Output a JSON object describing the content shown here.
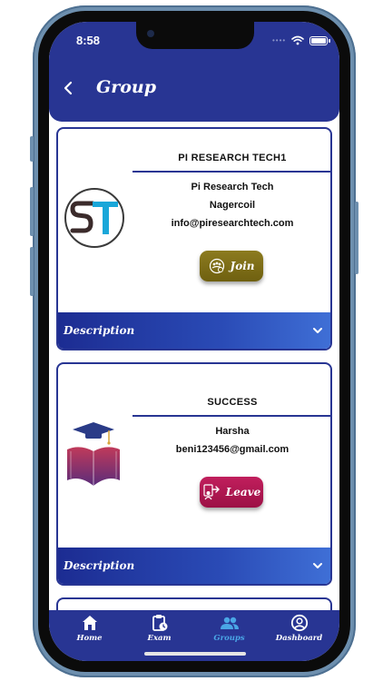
{
  "status_bar": {
    "time": "8:58"
  },
  "header": {
    "title": "Group"
  },
  "groups": [
    {
      "name": "PI RESEARCH TECH1",
      "lines": [
        "Pi Research Tech",
        "Nagercoil",
        "info@piresearchtech.com"
      ],
      "action_label": "Join",
      "description_label": "Description"
    },
    {
      "name": "SUCCESS",
      "lines": [
        "Harsha",
        "beni123456@gmail.com"
      ],
      "action_label": "Leave",
      "description_label": "Description"
    }
  ],
  "bottom_nav": {
    "items": [
      {
        "label": "Home",
        "icon": "home-icon"
      },
      {
        "label": "Exam",
        "icon": "clipboard-clock-icon"
      },
      {
        "label": "Groups",
        "icon": "groups-icon",
        "active": true
      },
      {
        "label": "Dashboard",
        "icon": "account-circle-icon"
      }
    ]
  },
  "colors": {
    "primary": "#283593",
    "join": "#7d6d17",
    "leave": "#b0174f",
    "active_nav": "#4aa6e6"
  }
}
